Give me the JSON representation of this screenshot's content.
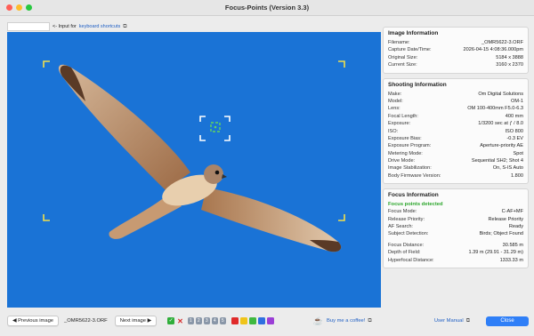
{
  "window": {
    "title": "Focus-Points (Version 3.3)"
  },
  "topbar": {
    "hint_text": "<- Input for",
    "link_text": "keyboard shortcuts"
  },
  "image_information": {
    "title": "Image Information",
    "rows": [
      {
        "k": "Filename:",
        "v": "_OMR5622-3.ORF"
      },
      {
        "k": "Capture Date/Time:",
        "v": "2026-04-15 4:08:36.000pm"
      },
      {
        "k": "Original Size:",
        "v": "5184 x 3888"
      },
      {
        "k": "Current Size:",
        "v": "3160 x 2370"
      }
    ]
  },
  "shooting_information": {
    "title": "Shooting Information",
    "rows": [
      {
        "k": "Make:",
        "v": "Om Digital Solutions"
      },
      {
        "k": "Model:",
        "v": "OM-1"
      },
      {
        "k": "Lens:",
        "v": "OM 100-400mm F5.0-6.3"
      },
      {
        "k": "Focal Length:",
        "v": "400 mm"
      },
      {
        "k": "Exposure:",
        "v": "1/3200 sec at ƒ / 8.0"
      },
      {
        "k": "ISO:",
        "v": "ISO 800"
      },
      {
        "k": "Exposure Bias:",
        "v": "-0.3 EV"
      },
      {
        "k": "Exposure Program:",
        "v": "Aperture-priority AE"
      },
      {
        "k": "Metering Mode:",
        "v": "Spot"
      },
      {
        "k": "Drive Mode:",
        "v": "Sequential SH2; Shot 4"
      },
      {
        "k": "Image Stabilization:",
        "v": "On, S-IS Auto"
      },
      {
        "k": "Body Firmware Version:",
        "v": "1.800"
      }
    ]
  },
  "focus_information": {
    "title": "Focus Information",
    "status": "Focus points detected",
    "rows": [
      {
        "k": "Focus Mode:",
        "v": "C-AF+MF"
      },
      {
        "k": "Release Priority:",
        "v": "Release Priority"
      },
      {
        "k": "AF Search:",
        "v": "Ready"
      },
      {
        "k": "Subject Detection:",
        "v": "Birds; Object Found"
      }
    ],
    "rows2": [
      {
        "k": "Focus Distance:",
        "v": "30.585 m"
      },
      {
        "k": "Depth of Field:",
        "v": "1.39 m (29.91 - 31.29 m)"
      },
      {
        "k": "Hyperfocal Distance:",
        "v": "1333.33 m"
      }
    ]
  },
  "bottombar": {
    "prev_label": "◀ Previous image",
    "filename": "_OMR5622-3.ORF",
    "next_label": "Next image ▶",
    "ratings": [
      "1",
      "2",
      "3",
      "4",
      "5"
    ],
    "colors": [
      "#e02a2a",
      "#f0c419",
      "#3fb93f",
      "#2f6fe0",
      "#9b3fd6"
    ],
    "coffee_label": "Buy me a coffee!",
    "manual_label": "User Manual",
    "close_label": "Close"
  },
  "colors": {
    "accent": "#2f7ff7",
    "focus_detected": "#2aa52a",
    "sky": "#1a73d6",
    "focus_frame": "#f2e04a",
    "focus_point": "#63d65e"
  }
}
